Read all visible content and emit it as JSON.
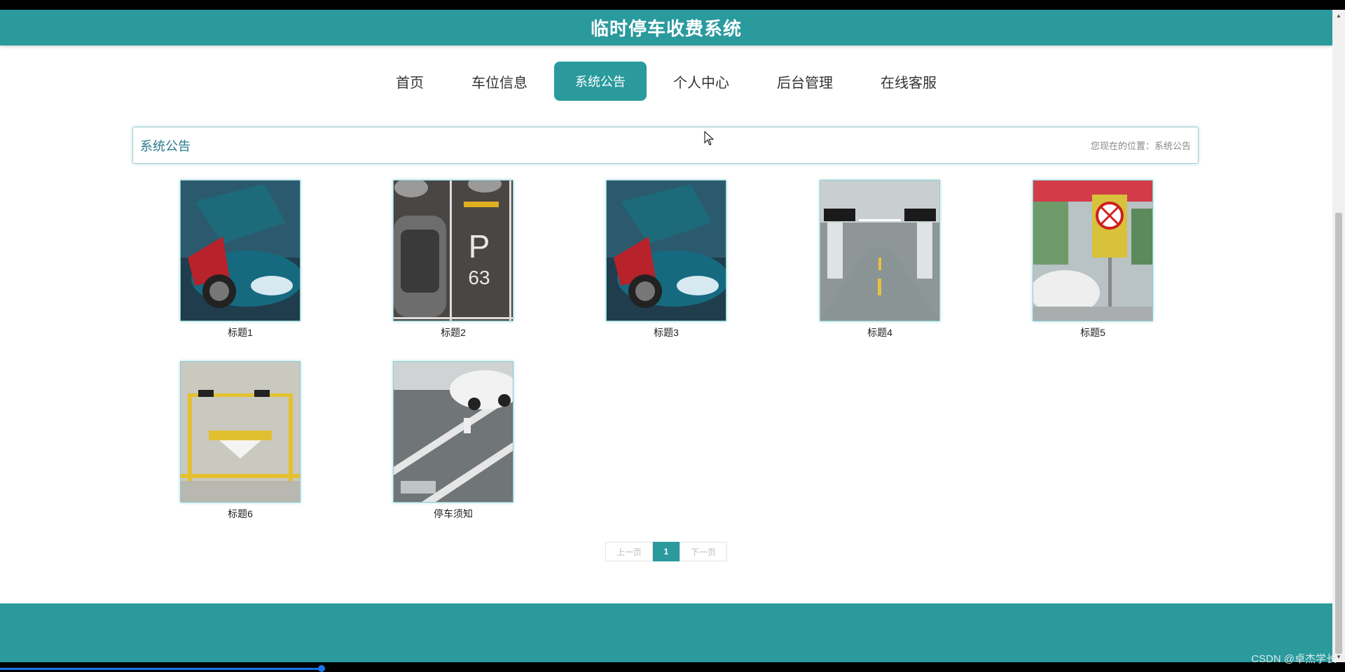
{
  "header": {
    "title": "临时停车收费系统"
  },
  "nav": {
    "items": [
      {
        "label": "首页"
      },
      {
        "label": "车位信息"
      },
      {
        "label": "系统公告"
      },
      {
        "label": "个人中心"
      },
      {
        "label": "后台管理"
      },
      {
        "label": "在线客服"
      }
    ],
    "active_index": 2
  },
  "breadcrumb": {
    "section_title": "系统公告",
    "location": "您现在的位置：系统公告"
  },
  "cards": [
    {
      "caption": "标题1",
      "image": "sports-car-image"
    },
    {
      "caption": "标题2",
      "image": "parking-lot-topview-image"
    },
    {
      "caption": "标题3",
      "image": "sports-car-image"
    },
    {
      "caption": "标题4",
      "image": "underground-garage-image"
    },
    {
      "caption": "标题5",
      "image": "no-parking-sign-image"
    },
    {
      "caption": "标题6",
      "image": "parking-space-image"
    },
    {
      "caption": "停车须知",
      "image": "parking-lot-car-image"
    }
  ],
  "pager": {
    "prev": "上一页",
    "current": "1",
    "next": "下一页"
  },
  "watermark": "CSDN @卓杰学长",
  "colors": {
    "accent": "#2a9a9d"
  }
}
